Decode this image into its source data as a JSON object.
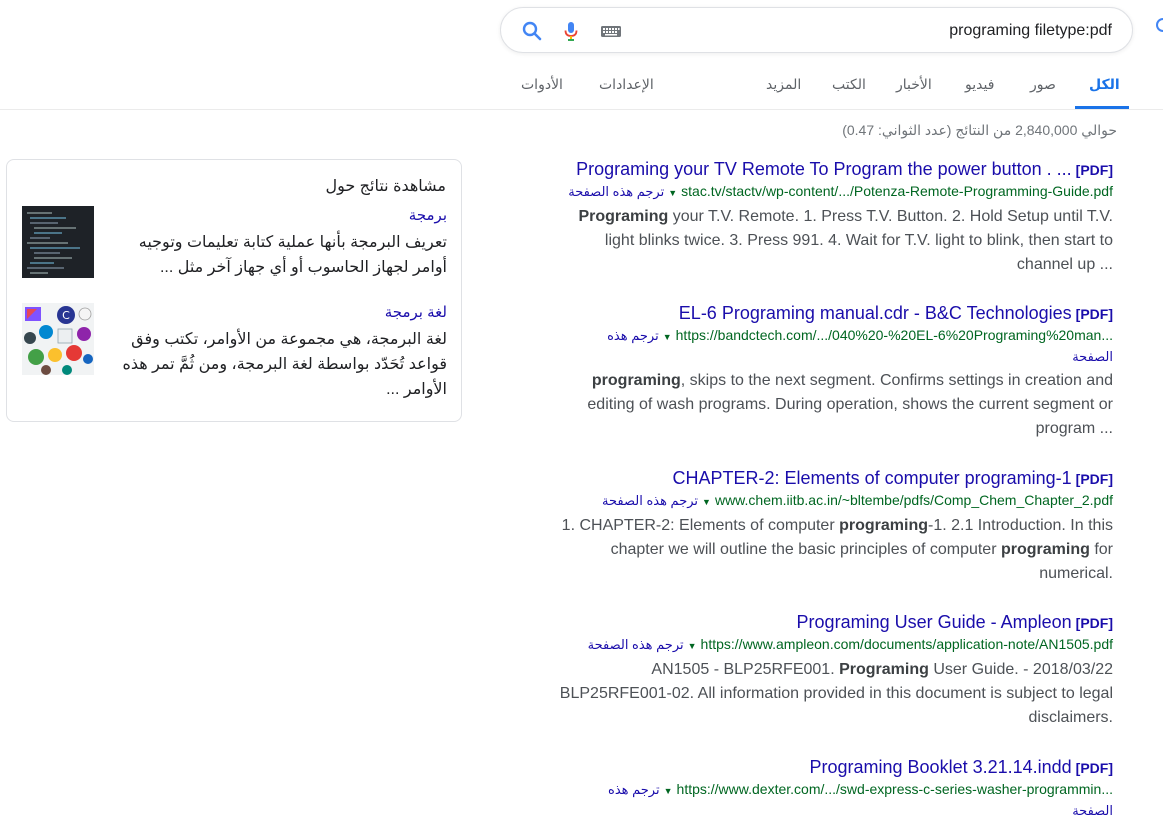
{
  "search": {
    "query": "programing filetype:pdf"
  },
  "tabs": [
    {
      "label": "الكل",
      "active": true
    },
    {
      "label": "صور"
    },
    {
      "label": "فيديو"
    },
    {
      "label": "الأخبار"
    },
    {
      "label": "الكتب"
    },
    {
      "label": "المزيد"
    },
    {
      "label": "الإعدادات"
    },
    {
      "label": "الأدوات"
    }
  ],
  "stats": "حوالي 2,840,000 من النتائج (عدد الثواني: 0.47)",
  "results": [
    {
      "filetype": "[PDF]",
      "title": "Programing your TV Remote To Program the power button . ...",
      "url": "stac.tv/stactv/wp-content/.../Potenza-Remote-Programming-Guide.pdf",
      "translate": "ترجم هذه الصفحة",
      "snippet_bold_1": "Programing",
      "snippet_rest_1": " your T.V. Remote. 1. Press T.V. Button. 2. Hold Setup until T.V. light blinks twice. 3. Press 991. 4. Wait for T.V. light to blink, then start to channel up ..."
    },
    {
      "filetype": "[PDF]",
      "title": "EL-6 Programing manual.cdr - B&C Technologies",
      "url": "https://bandctech.com/.../040%20-%20EL-6%20Programing%20man...",
      "translate": "ترجم هذه",
      "translate_cont": "الصفحة",
      "snippet_bold_1": "programing",
      "snippet_rest_1": ", skips to the next segment. Confirms settings in creation and editing of wash programs. During operation, shows the current segment or program ..."
    },
    {
      "filetype": "[PDF]",
      "title": "CHAPTER-2: Elements of computer programing-1",
      "url": "www.chem.iitb.ac.in/~bltembe/pdfs/Comp_Chem_Chapter_2.pdf",
      "translate": "ترجم هذه الصفحة",
      "snippet_part_1": "1. CHAPTER-2: Elements of computer ",
      "snippet_bold_1": "programing",
      "snippet_part_2": "-1. 2.1 Introduction. In this chapter we will outline the basic principles of computer ",
      "snippet_bold_2": "programing",
      "snippet_part_3": " for numerical."
    },
    {
      "filetype": "[PDF]",
      "title": "Programing User Guide - Ampleon",
      "url": "https://www.ampleon.com/documents/application-note/AN1505.pdf",
      "translate": "ترجم هذه الصفحة",
      "snippet_part_1": "AN1505 - BLP25RFE001. ",
      "snippet_bold_1": "Programing",
      "snippet_part_2": " User Guide. - 2018/03/22 BLP25RFE001-02. All information provided in this document is subject to legal disclaimers."
    },
    {
      "filetype": "[PDF]",
      "title": "Programing Booklet 3.21.14.indd",
      "url": "https://www.dexter.com/.../swd-express-c-series-washer-programmin...",
      "translate": "ترجم هذه",
      "translate_cont": "الصفحة"
    }
  ],
  "panel": {
    "heading": "مشاهدة نتائج حول",
    "items": [
      {
        "title": "برمجة",
        "description": "تعريف البرمجة بأنها عملية كتابة تعليمات وتوجيه أوامر لجهاز الحاسوب أو أي جهاز آخر مثل ..."
      },
      {
        "title": "لغة برمجة",
        "description": "لغة البرمجة، هي مجموعة من الأوامر، تكتب وفق قواعد تُحَدّد بواسطة لغة البرمجة، ومن ثُمَّ تمر هذه الأوامر ..."
      }
    ]
  },
  "colors": {
    "link": "#1a0dab",
    "url": "#006621",
    "accent": "#1a73e8",
    "snippet": "#4d5156"
  },
  "icons": [
    "search-icon",
    "microphone-icon",
    "keyboard-icon",
    "caret-down-icon",
    "code-thumbnail",
    "programming-languages-thumbnail"
  ]
}
